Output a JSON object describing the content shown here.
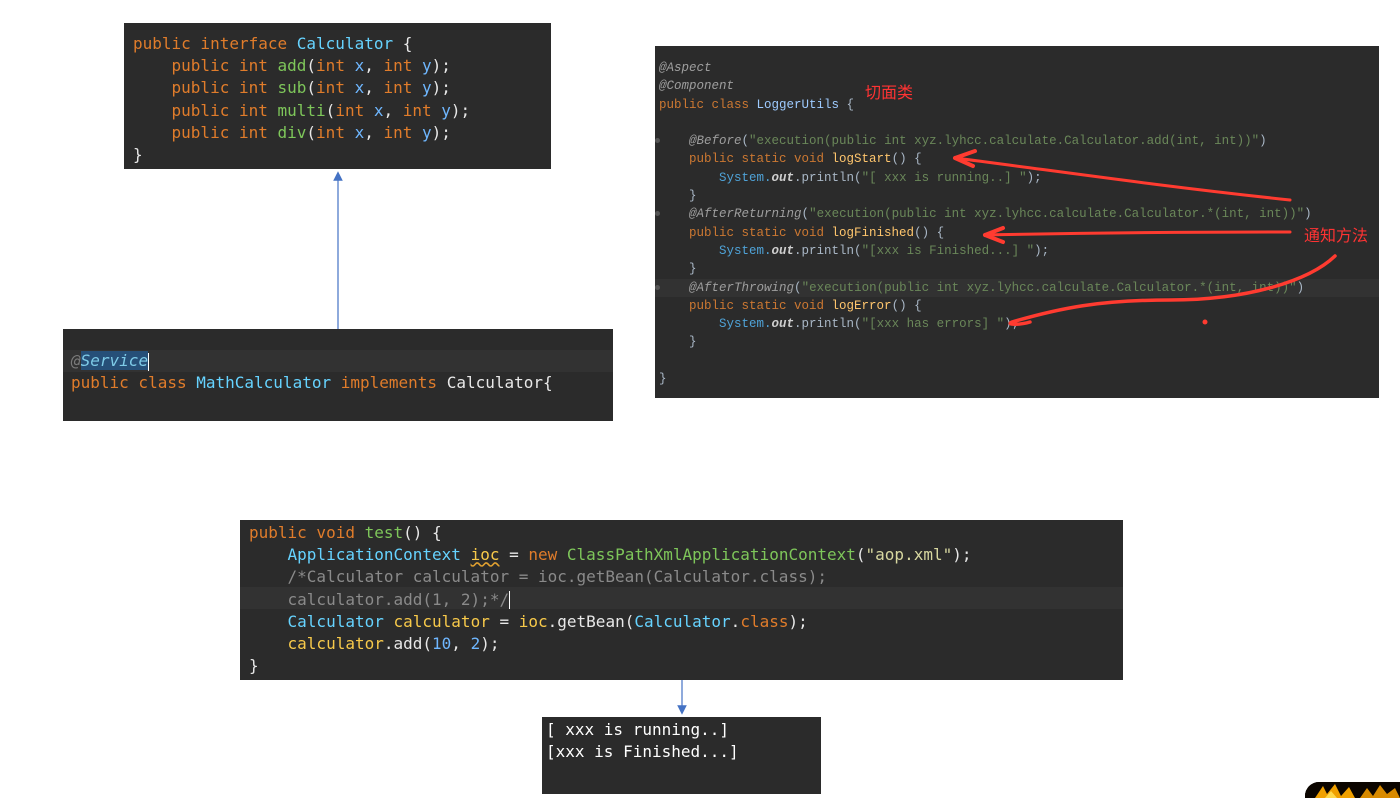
{
  "interface_panel": {
    "lines": [
      {
        "kw": "public interface ",
        "type": "Calculator",
        "rest": " {"
      },
      {
        "kw": "    public int ",
        "fn": "add",
        "p1": "(",
        "k1": "int ",
        "v1": "x",
        "c": ", ",
        "k2": "int ",
        "v2": "y",
        "end": ");"
      },
      {
        "kw": "    public int ",
        "fn": "sub",
        "p1": "(",
        "k1": "int ",
        "v1": "x",
        "c": ", ",
        "k2": "int ",
        "v2": "y",
        "end": ");"
      },
      {
        "kw": "    public int ",
        "fn": "multi",
        "p1": "(",
        "k1": "int ",
        "v1": "x",
        "c": ", ",
        "k2": "int ",
        "v2": "y",
        "end": ");"
      },
      {
        "kw": "    public int ",
        "fn": "div",
        "p1": "(",
        "k1": "int ",
        "v1": "x",
        "c": ", ",
        "k2": "int ",
        "v2": "y",
        "end": ");"
      }
    ],
    "closing": "}"
  },
  "math_panel": {
    "annotation_at": "@",
    "annotation_name": "Service",
    "kw_public_class": "public class ",
    "class_name": "MathCalculator",
    "kw_implements": " implements ",
    "iface": "Calculator",
    "brace": "{"
  },
  "aspect_panel": {
    "l1": "@Aspect",
    "l2": "@Component",
    "l3_kw": "public class ",
    "l3_cls": "LoggerUtils",
    "l3_end": " {",
    "before_ann": "@Before",
    "before_arg": "\"execution(public int xyz.lyhcc.calculate.Calculator.add(int, int))\"",
    "sig_kw": "public static void ",
    "logStart": "logStart",
    "logFinished": "logFinished",
    "logError": "logError",
    "sig_end": "() {",
    "sys": "System.",
    "out": "out",
    "println": ".println(",
    "msg_start": "\"[ xxx is running..] \"",
    "msg_finished": "\"[xxx is Finished...] \"",
    "msg_error": "\"[xxx has errors] \"",
    "stmt_end": ");",
    "close_brace": "}",
    "after_ret_ann": "@AfterReturning",
    "after_ret_arg": "\"execution(public int xyz.lyhcc.calculate.Calculator.*(int, int))\"",
    "after_throw_ann": "@AfterThrowing",
    "after_throw_arg": "\"execution(public int xyz.lyhcc.calculate.Calculator.*(int, int))\"",
    "paren_open": "(",
    "paren_close": ")"
  },
  "annotations": {
    "aspect_class_label": "切面类",
    "advice_method_label": "通知方法",
    "accent_color": "#ff3333"
  },
  "test_panel": {
    "l1_kw": "public void ",
    "l1_fn": "test",
    "l1_end": "() {",
    "l2_type": "ApplicationContext",
    "l2_var": "ioc",
    "l2_eq": " = ",
    "l2_new": "new ",
    "l2_cls": "ClassPathXmlApplicationContext",
    "l2_str": "\"aop.xml\"",
    "l2_end": ");",
    "l3_comment": "/*Calculator calculator = ioc.getBean(Calculator.class);",
    "l4_comment": "calculator.add(1, 2);*/",
    "l5_type": "Calculator",
    "l5_var": "calculator",
    "l5_mid": " = ",
    "l5_ioc": "ioc",
    "l5_get": ".getBean(",
    "l5_cls": "Calculator",
    "l5_dot": ".",
    "l5_class": "class",
    "l5_end": ");",
    "l6_var": "calculator",
    "l6_call": ".add(",
    "l6_n1": "10",
    "l6_c": ", ",
    "l6_n2": "2",
    "l6_end": ");",
    "l7": "}"
  },
  "console_panel": {
    "lines": [
      "[ xxx is running..]",
      "[xxx is Finished...]"
    ]
  }
}
